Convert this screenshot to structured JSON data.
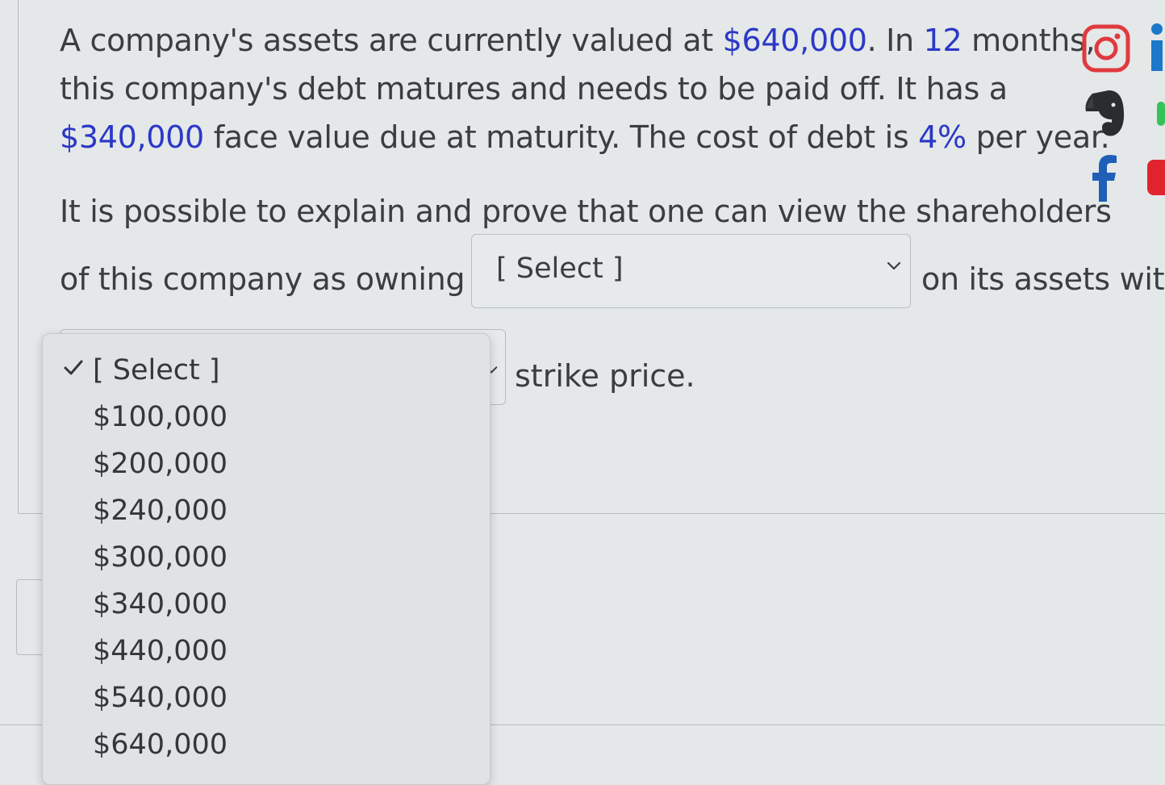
{
  "question": {
    "paragraph1": {
      "s1": "A company's assets are currently valued at ",
      "assets": "$640,000",
      "s2": ". In ",
      "months": "12",
      "s3": " months,",
      "line2": "this company's debt matures and needs to be paid off. It has a",
      "face_value": "$340,000",
      "s4": " face value due at maturity. The cost of debt is ",
      "rate": "4%",
      "s5": " per year."
    },
    "paragraph2": {
      "line1": "It is possible to explain and prove that one can view the shareholders",
      "prefix": "of this company as owning a",
      "suffix": "on its assets with",
      "tail": "strike price."
    }
  },
  "select1": {
    "value": "[ Select ]"
  },
  "dropdown": {
    "options": [
      "[ Select ]",
      "$100,000",
      "$200,000",
      "$240,000",
      "$300,000",
      "$340,000",
      "$440,000",
      "$540,000",
      "$640,000"
    ],
    "selected_index": 0
  },
  "social_icons": [
    "instagram-icon",
    "evernote-icon",
    "facebook-icon"
  ],
  "colors": {
    "background": "#e4e8e8",
    "text": "#3a3d41",
    "number_blue": "#2b38c7"
  }
}
